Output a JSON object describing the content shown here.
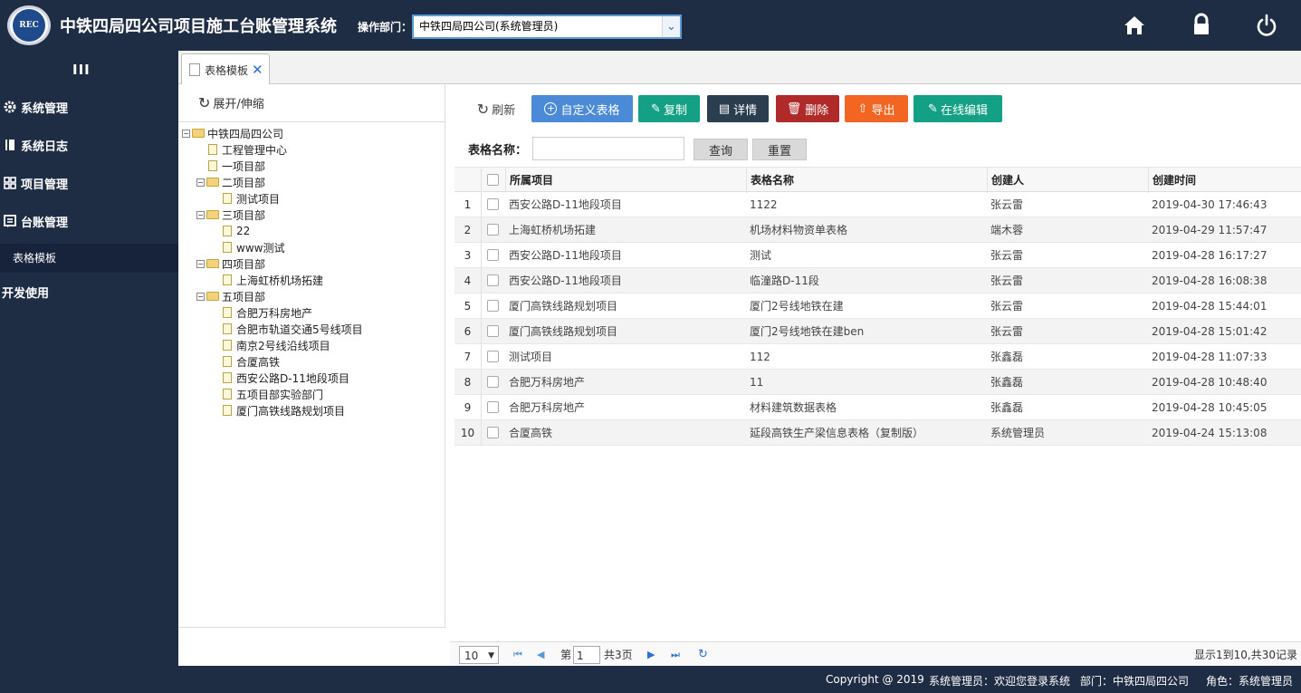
{
  "header": {
    "logo_text": "REC",
    "title": "中铁四局四公司项目施工台账管理系统",
    "dept_label": "操作部门：",
    "dept_value": "中铁四局四公司(系统管理员)"
  },
  "icons": {
    "home": "home-icon",
    "lock": "lock-icon",
    "power": "power-icon"
  },
  "sidebar": {
    "toggle": "III",
    "items": [
      {
        "label": "系统管理",
        "icon": "gear-icon"
      },
      {
        "label": "系统日志",
        "icon": "book-icon"
      },
      {
        "label": "项目管理",
        "icon": "grid-icon"
      },
      {
        "label": "台账管理",
        "icon": "ledger-icon"
      },
      {
        "label": "开发使用",
        "icon": ""
      }
    ],
    "submenu": {
      "label": "表格模板"
    }
  },
  "tab": {
    "label": "表格模板"
  },
  "tree": {
    "header": "展开/伸缩",
    "nodes": [
      {
        "label": "中铁四局四公司",
        "type": "folder",
        "level": 0
      },
      {
        "label": "工程管理中心",
        "type": "file",
        "level": 1
      },
      {
        "label": "一项目部",
        "type": "file",
        "level": 1
      },
      {
        "label": "二项目部",
        "type": "folder",
        "level": 1
      },
      {
        "label": "测试项目",
        "type": "file",
        "level": 2
      },
      {
        "label": "三项目部",
        "type": "folder",
        "level": 1
      },
      {
        "label": "22",
        "type": "file",
        "level": 2
      },
      {
        "label": "www测试",
        "type": "file",
        "level": 2
      },
      {
        "label": "四项目部",
        "type": "folder",
        "level": 1
      },
      {
        "label": "上海虹桥机场拓建",
        "type": "file",
        "level": 2
      },
      {
        "label": "五项目部",
        "type": "folder",
        "level": 1
      },
      {
        "label": "合肥万科房地产",
        "type": "file",
        "level": 2
      },
      {
        "label": "合肥市轨道交通5号线项目",
        "type": "file",
        "level": 2
      },
      {
        "label": "南京2号线沿线项目",
        "type": "file",
        "level": 2
      },
      {
        "label": "合厦高铁",
        "type": "file",
        "level": 2
      },
      {
        "label": "西安公路D-11地段项目",
        "type": "file",
        "level": 2
      },
      {
        "label": "五项目部实验部门",
        "type": "file",
        "level": 2
      },
      {
        "label": "厦门高铁线路规划项目",
        "type": "file",
        "level": 2
      }
    ]
  },
  "toolbar": {
    "refresh": "刷新",
    "custom": "自定义表格",
    "copy": "复制",
    "detail": "详情",
    "delete": "删除",
    "export": "导出",
    "online_edit": "在线编辑",
    "colors": {
      "custom": "#4a8ad6",
      "copy": "#14a085",
      "detail": "#2b3e50",
      "delete": "#b02a2a",
      "export": "#f26522",
      "online_edit": "#14a085"
    }
  },
  "search": {
    "label": "表格名称：",
    "value": "",
    "query_button": "查询",
    "reset_button": "重置"
  },
  "table": {
    "columns": [
      "所属项目",
      "表格名称",
      "创建人",
      "创建时间"
    ],
    "rows": [
      {
        "no": "1",
        "project": "西安公路D-11地段项目",
        "name": "1122",
        "creator": "张云雷",
        "time": "2019-04-30 17:46:43"
      },
      {
        "no": "2",
        "project": "上海虹桥机场拓建",
        "name": "机场材料物资单表格",
        "creator": "端木蓉",
        "time": "2019-04-29 11:57:47"
      },
      {
        "no": "3",
        "project": "西安公路D-11地段项目",
        "name": "测试",
        "creator": "张云雷",
        "time": "2019-04-28 16:17:27"
      },
      {
        "no": "4",
        "project": "西安公路D-11地段项目",
        "name": "临潼路D-11段",
        "creator": "张云雷",
        "time": "2019-04-28 16:08:38"
      },
      {
        "no": "5",
        "project": "厦门高铁线路规划项目",
        "name": "厦门2号线地铁在建",
        "creator": "张云雷",
        "time": "2019-04-28 15:44:01"
      },
      {
        "no": "6",
        "project": "厦门高铁线路规划项目",
        "name": "厦门2号线地铁在建ben",
        "creator": "张云雷",
        "time": "2019-04-28 15:01:42"
      },
      {
        "no": "7",
        "project": "测试项目",
        "name": "112",
        "creator": "张鑫磊",
        "time": "2019-04-28 11:07:33"
      },
      {
        "no": "8",
        "project": "合肥万科房地产",
        "name": "11",
        "creator": "张鑫磊",
        "time": "2019-04-28 10:48:40"
      },
      {
        "no": "9",
        "project": "合肥万科房地产",
        "name": "材料建筑数据表格",
        "creator": "张鑫磊",
        "time": "2019-04-28 10:45:05"
      },
      {
        "no": "10",
        "project": "合厦高铁",
        "name": "延段高铁生产梁信息表格（复制版）",
        "creator": "系统管理员",
        "time": "2019-04-24 15:13:08"
      }
    ]
  },
  "pager": {
    "page_size": "10",
    "page_prefix": "第",
    "page_number": "1",
    "page_suffix": "共3页",
    "summary": "显示1到10,共30记录"
  },
  "footer": {
    "copyright": "Copyright @ 2019",
    "welcome": "系统管理员：欢迎您登录系统",
    "dept": "部门：中铁四局四公司",
    "role": "角色：系统管理员"
  }
}
